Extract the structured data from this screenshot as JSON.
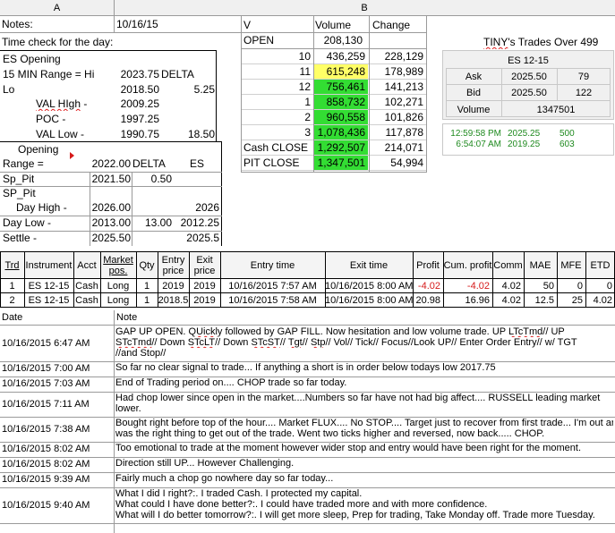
{
  "columns": {
    "a": "A",
    "b": "B"
  },
  "notes": {
    "label": "Notes:",
    "date": "10/16/15"
  },
  "time_check": "Time check for the day:",
  "es_opening": {
    "title": "ES Opening",
    "range_label": "15 MIN Range = Hi",
    "range_hi": "2023.75",
    "delta_label": "DELTA",
    "lo_label": "Lo",
    "lo_value": "2018.50",
    "delta_value": "5.25",
    "val_high_label": "VAL HIgh -",
    "val_high_value": "2009.25",
    "poc_label": "POC -",
    "poc_value": "1997.25",
    "val_low_label": "VAL Low -",
    "val_low_value": "1990.75",
    "val_delta": "18.50"
  },
  "opening_range": {
    "title": "Opening",
    "range_label": "Range =",
    "range_value": "2022.00",
    "delta_label": "DELTA",
    "es_label": "ES",
    "sp_pit_label": "Sp_Pit",
    "sp_pit_value": "2021.50",
    "sp_pit_delta": "0.50",
    "sp_pit2_label": "SP_Pit",
    "day_high_label": "Day High -",
    "day_high_value": "2026.00",
    "day_high_es": "2026",
    "day_low_label": "Day Low -",
    "day_low_value": "2013.00",
    "day_low_delta": "13.00",
    "day_low_es": "2012.25",
    "settle_label": "Settle -",
    "settle_value": "2025.50",
    "settle_es": "2025.5"
  },
  "volume_table": {
    "headers": [
      "V",
      "Volume",
      "Change"
    ],
    "open_label": "OPEN",
    "open_volume": "208,130",
    "rows": [
      {
        "label": "10",
        "volume": "436,259",
        "change": "228,129",
        "color": "#ffffff"
      },
      {
        "label": "11",
        "volume": "615,248",
        "change": "178,989",
        "color": "#ffff66"
      },
      {
        "label": "12",
        "volume": "756,461",
        "change": "141,213",
        "color": "#33dd33"
      },
      {
        "label": "1",
        "volume": "858,732",
        "change": "102,271",
        "color": "#33dd33"
      },
      {
        "label": "2",
        "volume": "960,558",
        "change": "101,826",
        "color": "#33dd33"
      },
      {
        "label": "3",
        "volume": "1,078,436",
        "change": "117,878",
        "color": "#33dd33"
      },
      {
        "label": "Cash CLOSE",
        "volume": "1,292,507",
        "change": "214,071",
        "color": "#33dd33"
      },
      {
        "label": "PIT CLOSE",
        "volume": "1,347,501",
        "change": "54,994",
        "color": "#33dd33"
      }
    ]
  },
  "tiny_title": "TINY's Trades Over 499",
  "quote": {
    "symbol": "ES 12-15",
    "ask_label": "Ask",
    "ask_price": "2025.50",
    "ask_size": "79",
    "bid_label": "Bid",
    "bid_price": "2025.50",
    "bid_size": "122",
    "volume_label": "Volume",
    "volume_value": "1347501"
  },
  "tiny_trades": [
    {
      "time": "12:59:58 PM",
      "price": "2025.25",
      "size": "500",
      "color": "#1f8a1f"
    },
    {
      "time": "6:54:07 AM",
      "price": "2019.25",
      "size": "603",
      "color": "#1f8a1f"
    }
  ],
  "trades": {
    "headers": [
      "Trd",
      "Instrument",
      "Acct",
      "Market pos.",
      "Qty",
      "Entry price",
      "Exit price",
      "Entry time",
      "Exit time",
      "Profit",
      "Cum. profit",
      "Comm",
      "MAE",
      "MFE",
      "ETD"
    ],
    "rows": [
      [
        "1",
        "ES 12-15",
        "Cash",
        "Long",
        "1",
        "2019",
        "2019",
        "10/16/2015 7:57 AM",
        "10/16/2015 8:00 AM",
        "-4.02",
        "-4.02",
        "4.02",
        "50",
        "0",
        "0"
      ],
      [
        "2",
        "ES 12-15",
        "Cash",
        "Long",
        "1",
        "2018.5",
        "2019",
        "10/16/2015 7:58 AM",
        "10/16/2015 8:00 AM",
        "20.98",
        "16.96",
        "4.02",
        "12.5",
        "25",
        "4.02"
      ]
    ]
  },
  "journal": {
    "headers": [
      "Date",
      "Note"
    ],
    "entries": [
      {
        "date": "10/16/2015 6:47 AM",
        "lines": [
          "GAP UP OPEN.  QUickly followed by GAP FILL.  Now hesitation and low volume trade.  UP  LTcTmd// UP",
          "STcTmd// Down STcLT// Down STcST// Tgt// Stp// Vol// Tick// Focus//Look UP// Enter Order Entry// w/ TGT",
          "//and Stop//"
        ]
      },
      {
        "date": "10/16/2015 7:00 AM",
        "lines": [
          "So far no clear signal to trade... If anything a short is in order below todays low 2017.75"
        ]
      },
      {
        "date": "10/16/2015 7:03 AM",
        "lines": [
          "End of Trading period on.... CHOP trade so far today."
        ]
      },
      {
        "date": "10/16/2015 7:11 AM",
        "lines": [
          "Had chop lower since open in the market....Numbers so far have not had big affect....  RUSSELL leading market",
          "lower."
        ]
      },
      {
        "date": "10/16/2015 7:38 AM",
        "lines": [
          "Bought right before top of the hour.... Market FLUX.... No STOP.... Target just to recover from first trade... I'm out and",
          "was the right thing to get out of the trade.  Went two ticks higher and reversed, now back..... CHOP."
        ]
      },
      {
        "date": "10/16/2015 8:02 AM",
        "lines": [
          "Too emotional to trade at the moment however wider stop and entry would have been right for the moment."
        ]
      },
      {
        "date": "10/16/2015 8:02 AM",
        "lines": [
          "Direction still UP... However Challenging."
        ]
      },
      {
        "date": "10/16/2015 9:39 AM",
        "lines": [
          "Fairly much a chop go nowhere day so far today..."
        ]
      },
      {
        "date": "10/16/2015 9:40 AM",
        "lines": [
          "What I did I right?:.  I traded Cash.  I protected my capital.",
          "What could I have done better?:.  I could have traded more and with more confidence.",
          "What will I do better tomorrow?:.  I will get more sleep, Prep for trading, Take Monday off.  Trade more Tuesday."
        ]
      }
    ]
  }
}
